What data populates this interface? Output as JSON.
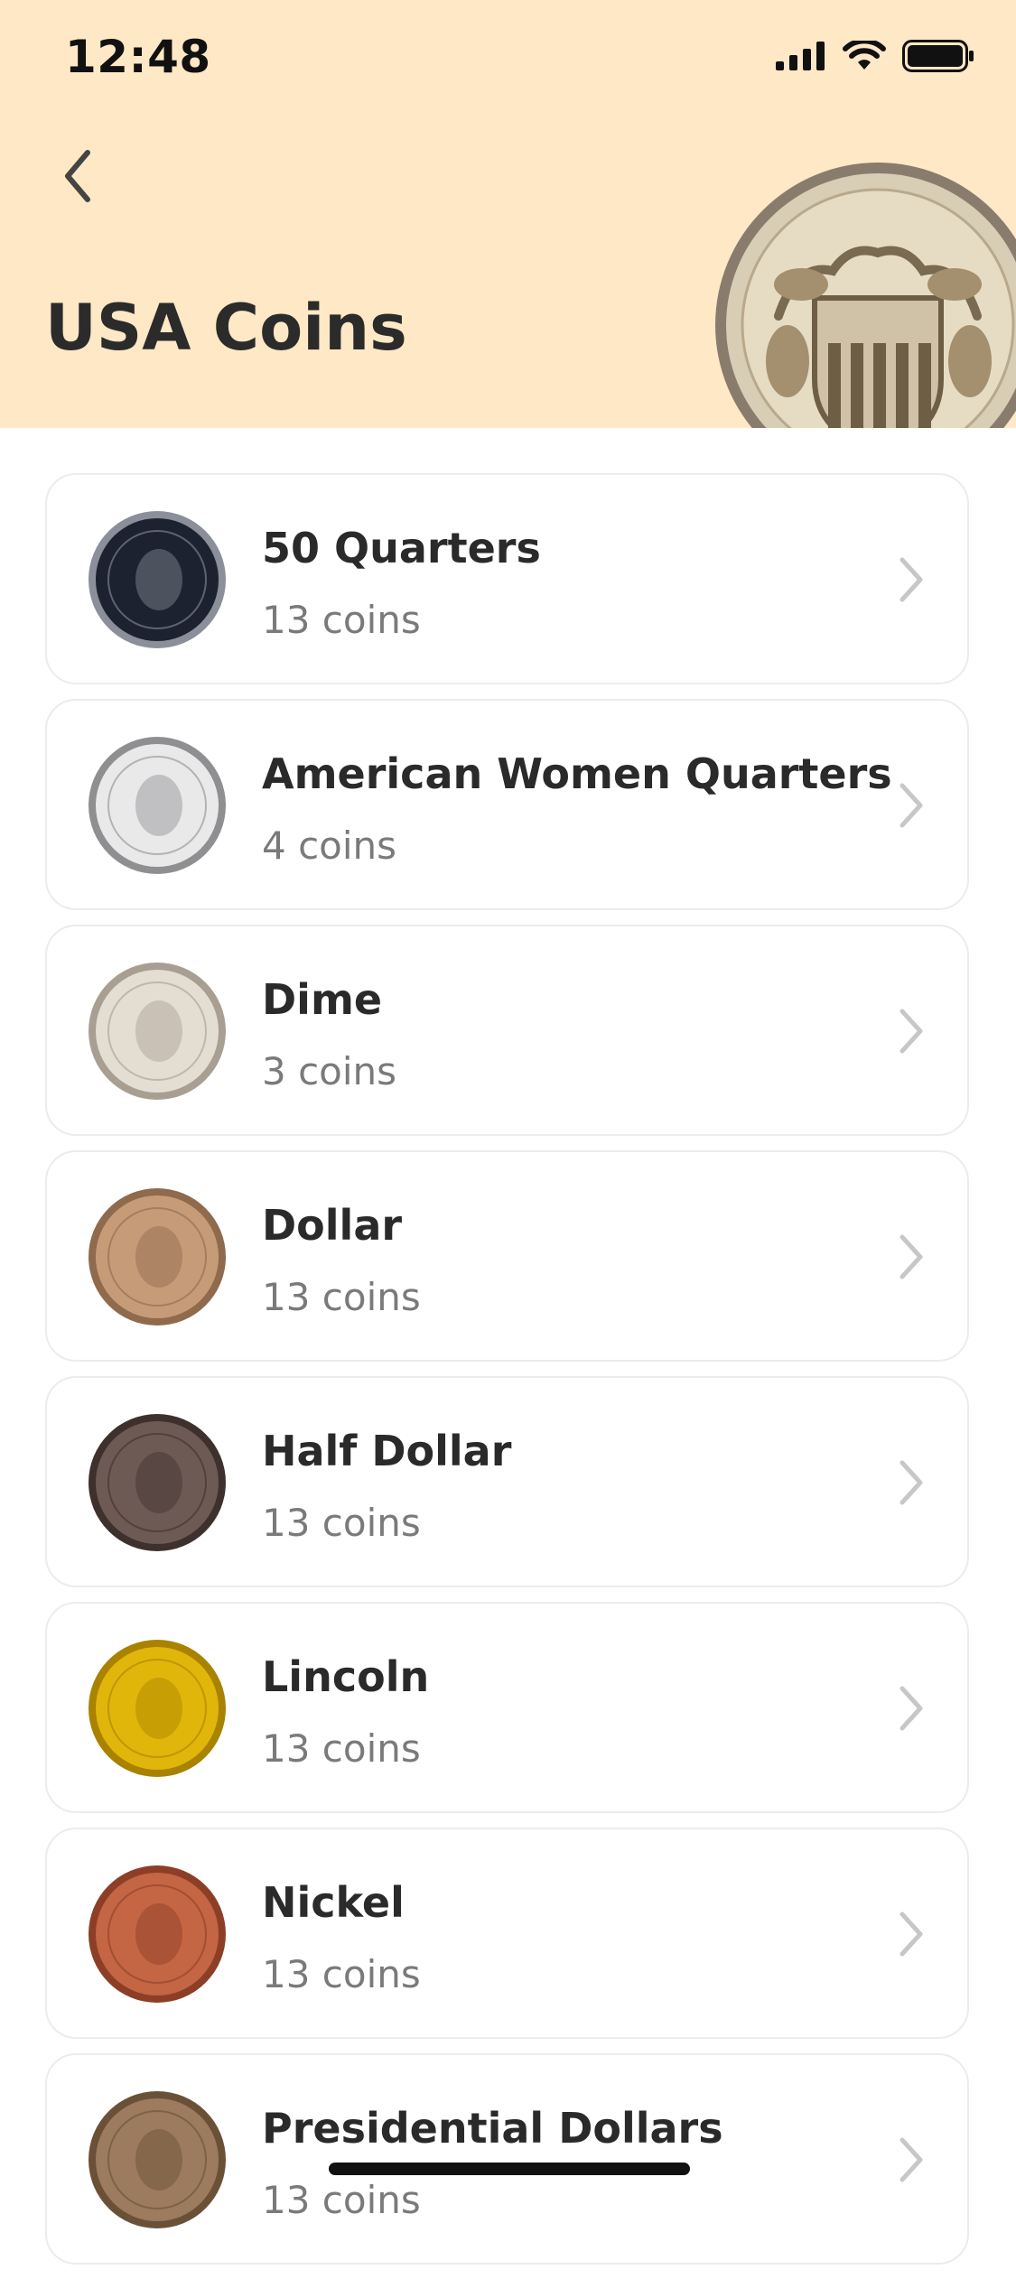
{
  "status_bar": {
    "time": "12:48",
    "icons": [
      "cellular-signal-icon",
      "wifi-icon",
      "battery-icon"
    ]
  },
  "header": {
    "title": "USA Coins",
    "back_icon": "chevron-left-icon",
    "background_color": "#ffe8c6"
  },
  "categories": [
    {
      "name": "50 Quarters",
      "count": "13 coins",
      "coin_color": "#1c2230",
      "coin_rim": "#8a8f99"
    },
    {
      "name": "American Women Quarters",
      "count": "4 coins",
      "coin_color": "#e9e9ea",
      "coin_rim": "#8f8f92"
    },
    {
      "name": "Dime",
      "count": "3 coins",
      "coin_color": "#e4ddd2",
      "coin_rim": "#a89f92"
    },
    {
      "name": "Dollar",
      "count": "13 coins",
      "coin_color": "#c69c78",
      "coin_rim": "#8f6a4c"
    },
    {
      "name": "Half Dollar",
      "count": "13 coins",
      "coin_color": "#6e5a55",
      "coin_rim": "#3e302c"
    },
    {
      "name": "Lincoln",
      "count": "13 coins",
      "coin_color": "#e0b60a",
      "coin_rim": "#a98200"
    },
    {
      "name": "Nickel",
      "count": "13 coins",
      "coin_color": "#c46544",
      "coin_rim": "#8c3f26"
    },
    {
      "name": "Presidential Dollars",
      "count": "13 coins",
      "coin_color": "#9c7b5e",
      "coin_rim": "#6b5038"
    }
  ],
  "colors": {
    "card_border": "#ececec",
    "chevron": "#c7c7c7",
    "subtitle": "#7a7a7a"
  }
}
